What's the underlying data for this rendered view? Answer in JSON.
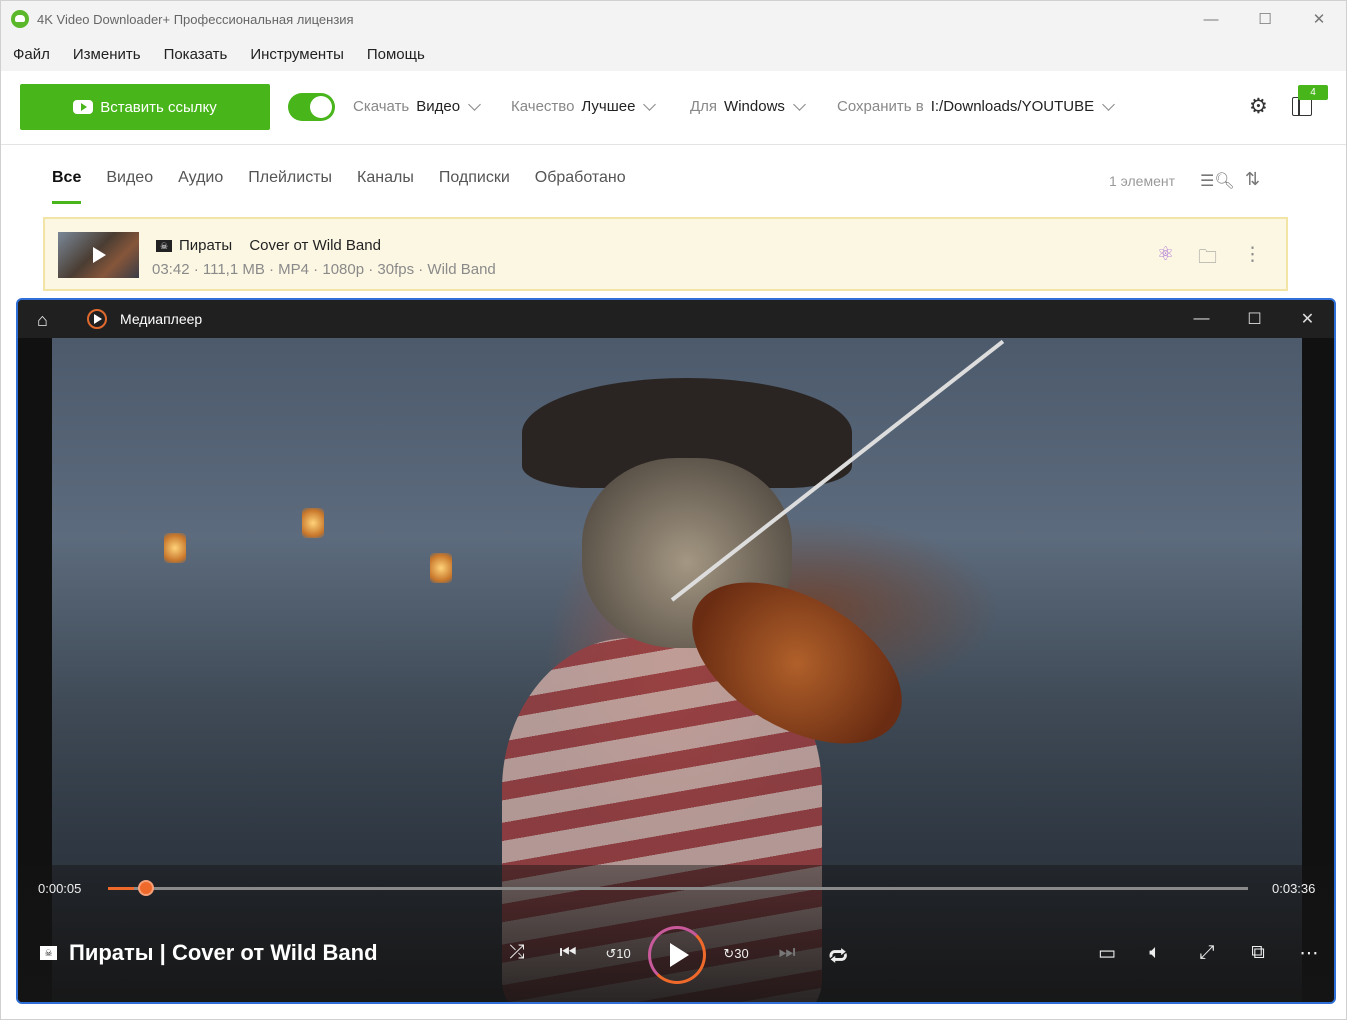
{
  "app": {
    "title": "4K Video Downloader+ Профессиональная лицензия",
    "window_buttons": [
      "—",
      "☐",
      "✕"
    ]
  },
  "menu": [
    "Файл",
    "Изменить",
    "Показать",
    "Инструменты",
    "Помощь"
  ],
  "toolbar": {
    "paste_label": "Вставить ссылку",
    "download_label": "Скачать",
    "download_value": "Видео",
    "quality_label": "Качество",
    "quality_value": "Лучшее",
    "for_label": "Для",
    "for_value": "Windows",
    "save_label": "Сохранить в",
    "save_value": "I:/Downloads/YOUTUBE",
    "queue_badge": "4"
  },
  "tabs": [
    "Все",
    "Видео",
    "Аудио",
    "Плейлисты",
    "Каналы",
    "Подписки",
    "Обработано"
  ],
  "active_tab": "Все",
  "item_count": "1 элемент",
  "item": {
    "artist": "Пираты",
    "title": "Cover от Wild Band",
    "meta": "03:42 · 111,1 MB · MP4 · 1080p · 30fps · Wild Band"
  },
  "player": {
    "window_title": "Медиаплеер",
    "current_time": "0:00:05",
    "total_time": "0:03:36",
    "progress": 0.023,
    "now_playing": "Пираты | Cover от Wild Band",
    "skip_back_label": "10",
    "skip_fwd_label": "30"
  },
  "colors": {
    "brand_green": "#48b51a",
    "accent_orange": "#ef6a2a",
    "item_highlight": "#fcf7e3",
    "player_border": "#2f6fd6"
  }
}
